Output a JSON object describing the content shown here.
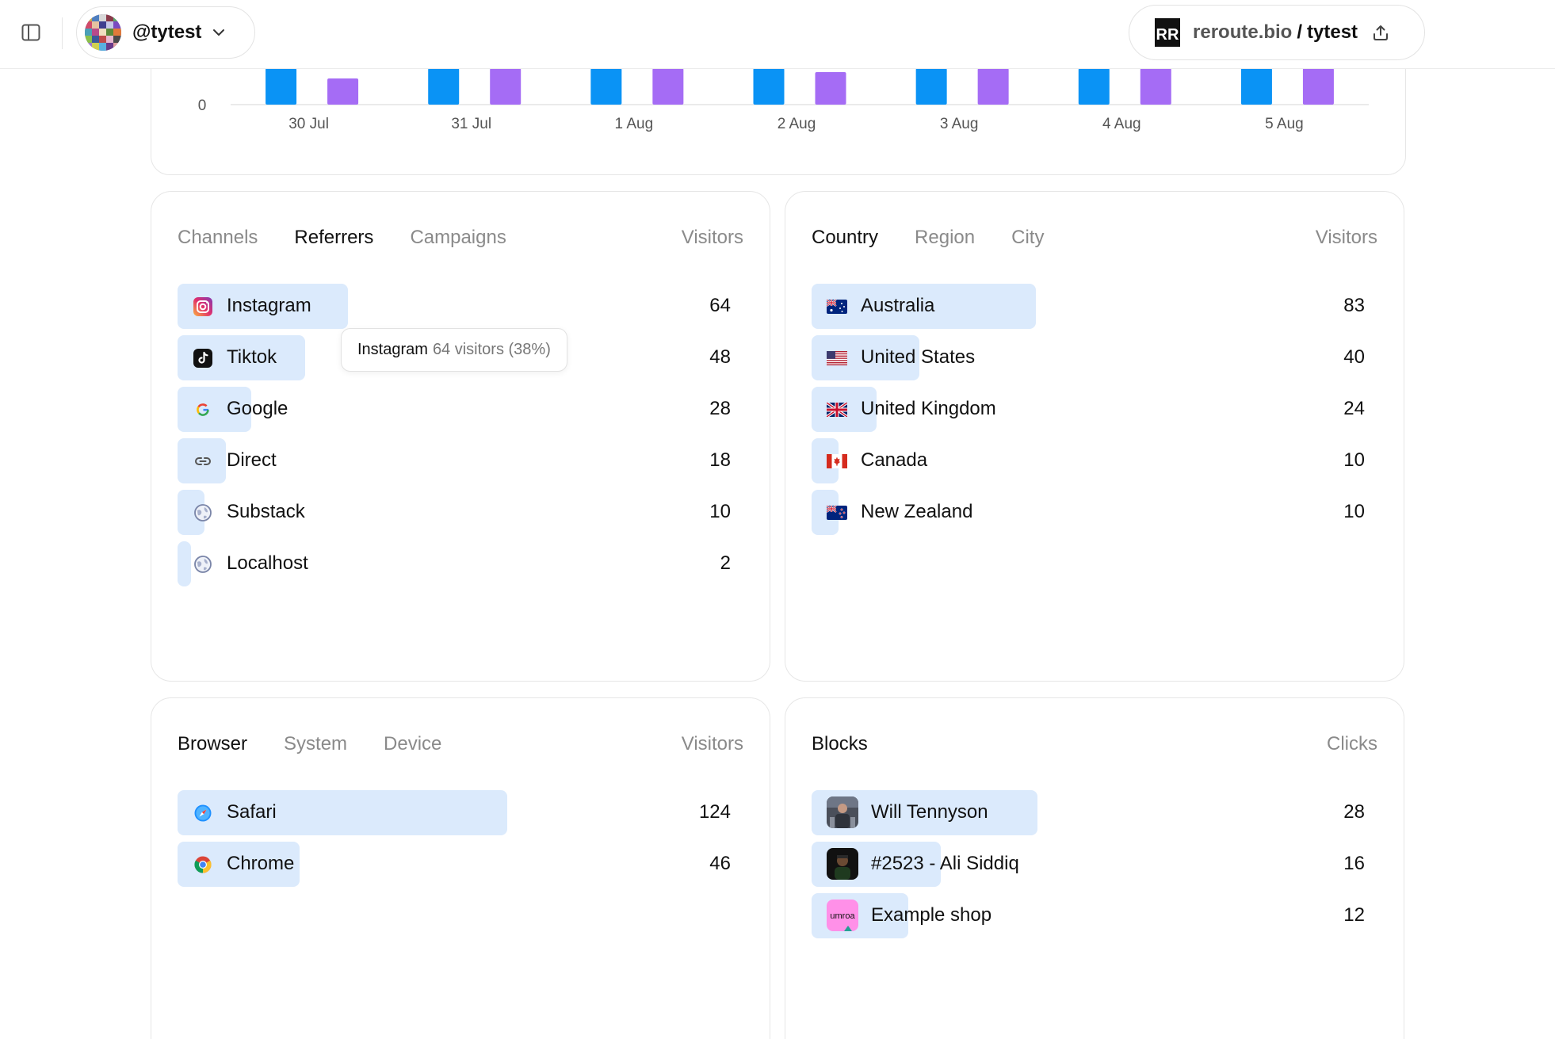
{
  "header": {
    "account_name": "@tytest",
    "site_domain": "reroute.bio",
    "site_separator": "/",
    "site_user": "tytest",
    "logo_text": "RR"
  },
  "chart_data": {
    "type": "bar",
    "categories": [
      "30 Jul",
      "31 Jul",
      "1 Aug",
      "2 Aug",
      "3 Aug",
      "4 Aug",
      "5 Aug"
    ],
    "series": [
      {
        "color": "#0a93f5",
        "values": [
          46,
          46,
          46,
          46,
          46,
          46,
          46
        ]
      },
      {
        "color": "#a56cf5",
        "values": [
          33,
          46,
          46,
          41,
          46,
          46,
          46
        ]
      }
    ],
    "y_tick_labels": [
      "0"
    ],
    "ylim": [
      0,
      46
    ],
    "grid": false,
    "note": "Chart is scrolled; only the bottom of the bars is visible."
  },
  "sources": {
    "tabs": [
      "Channels",
      "Referrers",
      "Campaigns"
    ],
    "active_tab": "Referrers",
    "column_header": "Visitors",
    "rows": [
      {
        "label": "Instagram",
        "value": "64",
        "icon": "instagram-icon",
        "fraction": 0.3
      },
      {
        "label": "Tiktok",
        "value": "48",
        "icon": "tiktok-icon",
        "fraction": 0.225
      },
      {
        "label": "Google",
        "value": "28",
        "icon": "google-icon",
        "fraction": 0.13
      },
      {
        "label": "Direct",
        "value": "18",
        "icon": "link-icon",
        "fraction": 0.085
      },
      {
        "label": "Substack",
        "value": "10",
        "icon": "globe-icon",
        "fraction": 0.047
      },
      {
        "label": "Localhost",
        "value": "2",
        "icon": "globe-icon",
        "fraction": 0.024
      }
    ],
    "tooltip": {
      "name": "Instagram",
      "detail": "64 visitors (38%)"
    }
  },
  "locations": {
    "tabs": [
      "Country",
      "Region",
      "City"
    ],
    "active_tab": "Country",
    "column_header": "Visitors",
    "rows": [
      {
        "label": "Australia",
        "value": "83",
        "icon": "australia-flag-icon",
        "fraction": 0.395
      },
      {
        "label": "United States",
        "value": "40",
        "icon": "us-flag-icon",
        "fraction": 0.19
      },
      {
        "label": "United Kingdom",
        "value": "24",
        "icon": "uk-flag-icon",
        "fraction": 0.115
      },
      {
        "label": "Canada",
        "value": "10",
        "icon": "canada-flag-icon",
        "fraction": 0.048
      },
      {
        "label": "New Zealand",
        "value": "10",
        "icon": "new-zealand-flag-icon",
        "fraction": 0.048
      }
    ]
  },
  "tech": {
    "tabs": [
      "Browser",
      "System",
      "Device"
    ],
    "active_tab": "Browser",
    "column_header": "Visitors",
    "rows": [
      {
        "label": "Safari",
        "value": "124",
        "icon": "safari-icon",
        "fraction": 0.58
      },
      {
        "label": "Chrome",
        "value": "46",
        "icon": "chrome-icon",
        "fraction": 0.215
      }
    ]
  },
  "blocks": {
    "title": "Blocks",
    "column_header": "Clicks",
    "rows": [
      {
        "label": "Will Tennyson",
        "value": "28",
        "icon": "block-thumbnail-icon",
        "fraction": 0.398
      },
      {
        "label": "#2523 - Ali Siddiq",
        "value": "16",
        "icon": "block-thumbnail-icon",
        "fraction": 0.227
      },
      {
        "label": "Example shop",
        "value": "12",
        "icon": "block-thumbnail-icon",
        "fraction": 0.17,
        "thumb_text": "umroa"
      }
    ]
  }
}
